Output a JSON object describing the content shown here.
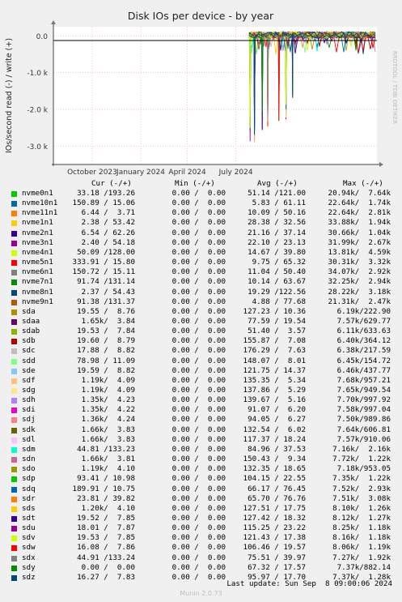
{
  "chart_data": {
    "type": "line",
    "title": "Disk IOs per device - by year",
    "ylabel": "IOs/second read (-) / write (+)",
    "watermark": "RRDTOOL / TOBI OETIKER",
    "yticks": [
      {
        "value": 0,
        "label": "0.0"
      },
      {
        "value": -1000,
        "label": "-1.0 k"
      },
      {
        "value": -2000,
        "label": "-2.0 k"
      },
      {
        "value": -3000,
        "label": "-3.0 k"
      }
    ],
    "ylim": [
      -3500,
      250
    ],
    "xticks": [
      {
        "label": "October 2023",
        "pos": 0.2
      },
      {
        "label": "January 2024",
        "pos": 0.45
      },
      {
        "label": "April 2024",
        "pos": 0.69
      },
      {
        "label": "July 2024",
        "pos": 0.94
      }
    ],
    "data_start_fraction": 0.605,
    "spikes": [
      {
        "pos": 0.61,
        "depth": -2900
      },
      {
        "pos": 0.68,
        "depth": -3250
      },
      {
        "pos": 0.825,
        "depth": -2600
      },
      {
        "pos": 0.92,
        "depth": -2500
      },
      {
        "pos": 1.14,
        "depth": -2350
      },
      {
        "pos": 1.27,
        "depth": -2300
      },
      {
        "pos": 1.39,
        "depth": -1700
      }
    ],
    "legend_header": {
      "cur": "Cur (-/+)",
      "min": "Min (-/+)",
      "avg": "Avg (-/+)",
      "max": "Max (-/+)"
    },
    "series": [
      {
        "name": "nvme0n1",
        "color": "#00cc00",
        "cur": "33.18 /193.26",
        "min": "0.00 /  0.00",
        "avg": "51.14 /121.00",
        "max": "20.94k/  7.64k"
      },
      {
        "name": "nvme10n1",
        "color": "#0066b3",
        "cur": "150.89 / 15.06",
        "min": "0.00 /  0.00",
        "avg": "5.83 / 61.11",
        "max": "22.64k/  1.74k"
      },
      {
        "name": "nvme11n1",
        "color": "#ff8000",
        "cur": "6.44 /  3.71",
        "min": "0.00 /  0.00",
        "avg": "10.09 / 50.16",
        "max": "22.64k/  2.81k"
      },
      {
        "name": "nvme1n1",
        "color": "#ffcc00",
        "cur": "2.38 / 53.42",
        "min": "0.00 /  0.00",
        "avg": "28.38 / 32.56",
        "max": "33.88k/  1.94k"
      },
      {
        "name": "nvme2n1",
        "color": "#330099",
        "cur": "6.54 / 62.26",
        "min": "0.00 /  0.00",
        "avg": "21.16 / 37.14",
        "max": "30.66k/  1.04k"
      },
      {
        "name": "nvme3n1",
        "color": "#990099",
        "cur": "2.40 / 54.18",
        "min": "0.00 /  0.00",
        "avg": "22.10 / 23.13",
        "max": "31.99k/  2.67k"
      },
      {
        "name": "nvme4n1",
        "color": "#ccff00",
        "cur": "50.09 /128.00",
        "min": "0.00 /  0.00",
        "avg": "14.67 / 39.80",
        "max": "13.81k/  4.59k"
      },
      {
        "name": "nvme5n1",
        "color": "#ff0000",
        "cur": "333.91 / 15.80",
        "min": "0.00 /  0.00",
        "avg": "9.75 / 65.32",
        "max": "30.31k/  3.32k"
      },
      {
        "name": "nvme6n1",
        "color": "#808080",
        "cur": "150.72 / 15.11",
        "min": "0.00 /  0.00",
        "avg": "11.04 / 50.40",
        "max": "34.07k/  2.92k"
      },
      {
        "name": "nvme7n1",
        "color": "#008f00",
        "cur": "91.74 /131.14",
        "min": "0.00 /  0.00",
        "avg": "10.14 / 63.67",
        "max": "32.25k/  2.94k"
      },
      {
        "name": "nvme8n1",
        "color": "#00487d",
        "cur": "2.37 / 54.43",
        "min": "0.00 /  0.00",
        "avg": "19.29 /122.56",
        "max": "28.22k/  3.18k"
      },
      {
        "name": "nvme9n1",
        "color": "#b35a00",
        "cur": "91.38 /131.37",
        "min": "0.00 /  0.00",
        "avg": "4.88 / 77.68",
        "max": "21.31k/  2.47k"
      },
      {
        "name": "sda",
        "color": "#b38f00",
        "cur": "19.55 /  8.76",
        "min": "0.00 /  0.00",
        "avg": "127.23 / 10.36",
        "max": "6.19k/222.90"
      },
      {
        "name": "sdaa",
        "color": "#6b006b",
        "cur": "1.65k/  3.84",
        "min": "0.00 /  0.00",
        "avg": "77.59 / 19.54",
        "max": "7.57k/629.77"
      },
      {
        "name": "sdab",
        "color": "#8fb300",
        "cur": "19.53 /  7.84",
        "min": "0.00 /  0.00",
        "avg": "51.40 /  3.57",
        "max": "6.11k/633.63"
      },
      {
        "name": "sdb",
        "color": "#b30000",
        "cur": "19.60 /  8.79",
        "min": "0.00 /  0.00",
        "avg": "155.87 /  7.08",
        "max": "6.40k/364.12"
      },
      {
        "name": "sdc",
        "color": "#bebebe",
        "cur": "17.88 /  8.82",
        "min": "0.00 /  0.00",
        "avg": "176.29 /  7.63",
        "max": "6.38k/217.59"
      },
      {
        "name": "sdd",
        "color": "#80ff80",
        "cur": "78.98 / 11.09",
        "min": "0.00 /  0.00",
        "avg": "148.07 /  8.01",
        "max": "6.45k/154.72"
      },
      {
        "name": "sde",
        "color": "#80c9ff",
        "cur": "19.59 /  8.82",
        "min": "0.00 /  0.00",
        "avg": "121.75 / 14.37",
        "max": "6.46k/437.77"
      },
      {
        "name": "sdf",
        "color": "#ffc080",
        "cur": "1.19k/  4.09",
        "min": "0.00 /  0.00",
        "avg": "135.35 /  5.34",
        "max": "7.68k/957.21"
      },
      {
        "name": "sdg",
        "color": "#ffe680",
        "cur": "1.19k/  4.09",
        "min": "0.00 /  0.00",
        "avg": "137.86 /  5.29",
        "max": "7.65k/949.54"
      },
      {
        "name": "sdh",
        "color": "#aa80ff",
        "cur": "1.35k/  4.23",
        "min": "0.00 /  0.00",
        "avg": "139.67 /  5.16",
        "max": "7.70k/997.92"
      },
      {
        "name": "sdi",
        "color": "#ee00cc",
        "cur": "1.35k/  4.22",
        "min": "0.00 /  0.00",
        "avg": "91.07 /  6.20",
        "max": "7.58k/997.04"
      },
      {
        "name": "sdj",
        "color": "#ff8080",
        "cur": "1.36k/  4.24",
        "min": "0.00 /  0.00",
        "avg": "94.05 /  6.27",
        "max": "7.50k/989.86"
      },
      {
        "name": "sdk",
        "color": "#666600",
        "cur": "1.66k/  3.83",
        "min": "0.00 /  0.00",
        "avg": "132.54 /  6.02",
        "max": "7.64k/606.81"
      },
      {
        "name": "sdl",
        "color": "#ffbfff",
        "cur": "1.66k/  3.83",
        "min": "0.00 /  0.00",
        "avg": "117.37 / 18.24",
        "max": "7.57k/910.06"
      },
      {
        "name": "sdm",
        "color": "#00ffcc",
        "cur": "44.81 /133.23",
        "min": "0.00 /  0.00",
        "avg": "84.96 / 37.53",
        "max": "7.16k/  2.16k"
      },
      {
        "name": "sdn",
        "color": "#cc6699",
        "cur": "1.66k/  3.81",
        "min": "0.00 /  0.00",
        "avg": "150.43 /  9.34",
        "max": "7.72k/  1.22k"
      },
      {
        "name": "sdo",
        "color": "#999900",
        "cur": "1.19k/  4.10",
        "min": "0.00 /  0.00",
        "avg": "132.35 / 18.65",
        "max": "7.18k/953.05"
      },
      {
        "name": "sdp",
        "color": "#00cc00",
        "cur": "93.41 / 10.98",
        "min": "0.00 /  0.00",
        "avg": "104.15 / 22.55",
        "max": "7.35k/  1.22k"
      },
      {
        "name": "sdq",
        "color": "#0066b3",
        "cur": "189.91 / 10.75",
        "min": "0.00 /  0.00",
        "avg": "66.17 / 76.45",
        "max": "7.52k/  2.93k"
      },
      {
        "name": "sdr",
        "color": "#ff8000",
        "cur": "23.81 / 39.82",
        "min": "0.00 /  0.00",
        "avg": "65.70 / 76.76",
        "max": "7.51k/  3.08k"
      },
      {
        "name": "sds",
        "color": "#ffcc00",
        "cur": "1.20k/  4.10",
        "min": "0.00 /  0.00",
        "avg": "127.51 / 17.75",
        "max": "8.10k/  1.26k"
      },
      {
        "name": "sdt",
        "color": "#330099",
        "cur": "19.52 /  7.85",
        "min": "0.00 /  0.00",
        "avg": "127.42 / 18.32",
        "max": "8.12k/  1.27k"
      },
      {
        "name": "sdu",
        "color": "#990099",
        "cur": "18.01 /  7.87",
        "min": "0.00 /  0.00",
        "avg": "115.25 / 23.22",
        "max": "8.25k/  1.18k"
      },
      {
        "name": "sdv",
        "color": "#ccff00",
        "cur": "19.53 /  7.85",
        "min": "0.00 /  0.00",
        "avg": "121.43 / 17.38",
        "max": "8.16k/  1.18k"
      },
      {
        "name": "sdw",
        "color": "#ff0000",
        "cur": "16.08 /  7.86",
        "min": "0.00 /  0.00",
        "avg": "106.46 / 19.57",
        "max": "8.06k/  1.19k"
      },
      {
        "name": "sdx",
        "color": "#808080",
        "cur": "44.91 /133.24",
        "min": "0.00 /  0.00",
        "avg": "75.51 / 39.97",
        "max": "7.27k/  1.92k"
      },
      {
        "name": "sdy",
        "color": "#008f00",
        "cur": "0.00 /  0.00",
        "min": "0.00 /  0.00",
        "avg": "67.32 / 17.57",
        "max": "7.37k/882.14"
      },
      {
        "name": "sdz",
        "color": "#00487d",
        "cur": "16.27 /  7.83",
        "min": "0.00 /  0.00",
        "avg": "95.97 / 17.70",
        "max": "7.37k/  1.28k"
      }
    ]
  },
  "footer": {
    "last_update": "Last update: Sun Sep  8 09:00:06 2024",
    "munin": "Munin 2.0.73"
  }
}
